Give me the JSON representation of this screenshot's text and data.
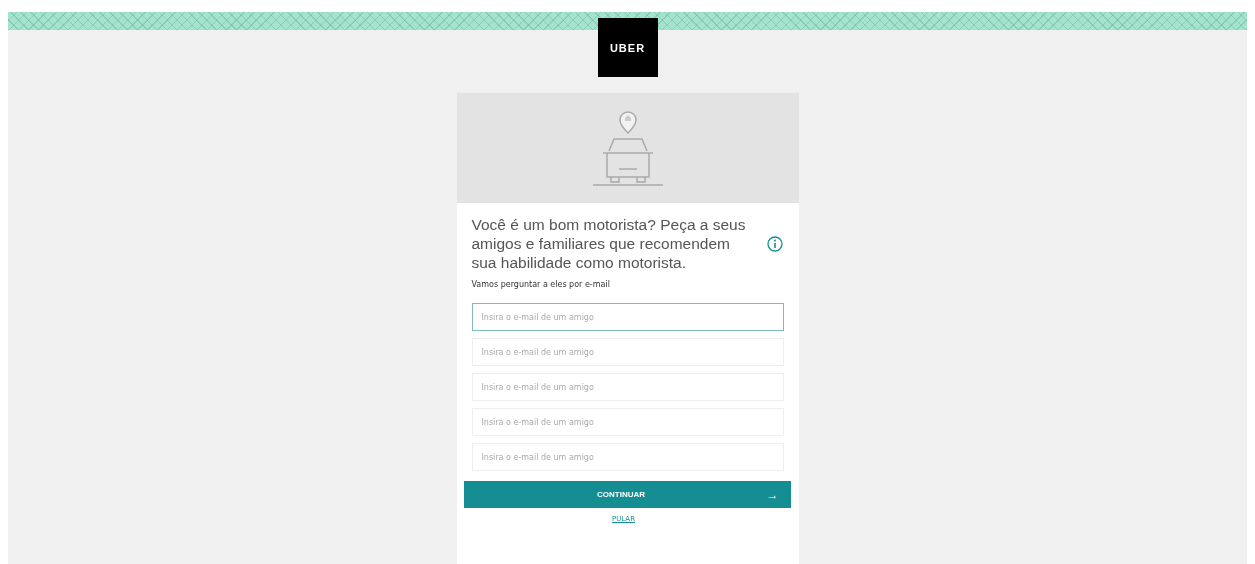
{
  "logo": {
    "text": "UBER"
  },
  "card": {
    "heading": "Você é um bom motorista? Peça a seus amigos e familiares que recomendem sua habilidade como motorista.",
    "subheading": "Vamos perguntar a eles por e-mail",
    "fields": [
      {
        "placeholder": "Insira o e-mail de um amigo",
        "focused": true
      },
      {
        "placeholder": "Insira o e-mail de um amigo",
        "focused": false
      },
      {
        "placeholder": "Insira o e-mail de um amigo",
        "focused": false
      },
      {
        "placeholder": "Insira o e-mail de um amigo",
        "focused": false
      },
      {
        "placeholder": "Insira o e-mail de um amigo",
        "focused": false
      }
    ],
    "continue_button": {
      "label": "CONTINUAR",
      "arrow": "→"
    },
    "skip_link": "PULAR"
  }
}
